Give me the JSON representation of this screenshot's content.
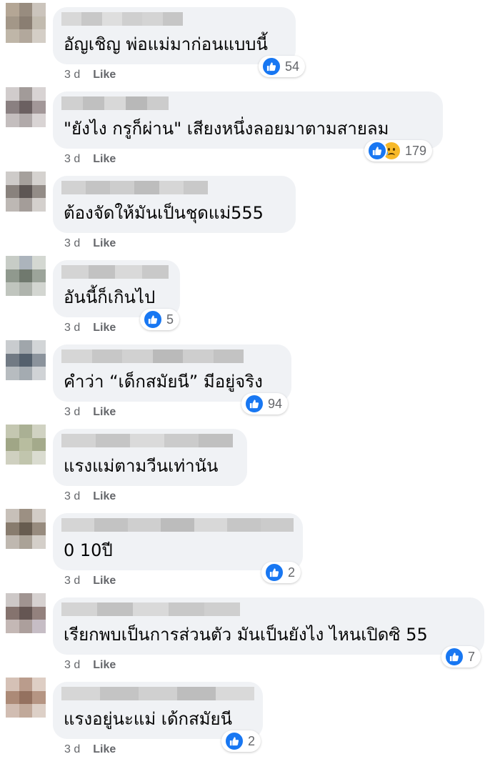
{
  "colors": {
    "bubble": "#f0f2f5",
    "like_blue": "#1877f2",
    "meta_gray": "#65676b",
    "sad_yellow": "#f7b928"
  },
  "comments": [
    {
      "text": "อัญเชิญ พ่อแม่มาก่อนแบบนี้",
      "time": "3 d",
      "like_label": "Like",
      "reaction_count": "54",
      "reactions": [
        "like-icon"
      ],
      "avatar": [
        "#b9a58d",
        "#9c8b79",
        "#cdc4b8",
        "#a89681",
        "#8e7d6c",
        "#c5bba9",
        "#c3b6a2",
        "#b5a896",
        "#d6cec2"
      ],
      "name_blur": [
        "#d8d8d8",
        "#c8c8c8",
        "#dedede",
        "#cfcfcf",
        "#d4d4d4",
        "#c6c6c6"
      ]
    },
    {
      "text": "\"ยังไง กรูก็ผ่าน\" เสียงหนึ่งลอยมาตามสายลม",
      "time": "3 d",
      "like_label": "Like",
      "reaction_count": "179",
      "reactions": [
        "like-icon",
        "sad-icon"
      ],
      "avatar": [
        "#d2cccc",
        "#a59a98",
        "#d9d3d3",
        "#8e7f80",
        "#6f5f60",
        "#a69697",
        "#c6bdbd",
        "#b3a9a9",
        "#dad4d4"
      ],
      "name_blur": [
        "#d0d0d0",
        "#c0c0c0",
        "#d8d8d8",
        "#b8b8b8",
        "#cccccc"
      ]
    },
    {
      "text": "ต้องจัดให้มันเป็นชุดแม่555",
      "time": "3 d",
      "like_label": "Like",
      "reaction_count": "",
      "reactions": [],
      "avatar": [
        "#cfcbc8",
        "#a7a09a",
        "#d6d2ce",
        "#8b817b",
        "#5f5652",
        "#958b85",
        "#bfb8b2",
        "#a69d97",
        "#d5d0cb"
      ],
      "name_blur": [
        "#d2d2d2",
        "#c4c4c4",
        "#cdcdcd",
        "#bdbdbd",
        "#d6d6d6",
        "#c9c9c9"
      ]
    },
    {
      "text": "อันนี้ก็เกินไป",
      "time": "3 d",
      "like_label": "Like",
      "reaction_count": "5",
      "reactions": [
        "like-icon"
      ],
      "avatar": [
        "#c6cdc4",
        "#a9b4c0",
        "#d3d8d0",
        "#8e9a8a",
        "#6d7a6b",
        "#9aa597",
        "#bfc6bc",
        "#aeb5ab",
        "#d2d6cf"
      ],
      "name_blur": [
        "#d4d4d4",
        "#c2c2c2",
        "#d9d9d9",
        "#c9c9c9"
      ]
    },
    {
      "text": "คำว่า “เด็กสมัยนี” มีอยู่จริง",
      "time": "3 d",
      "like_label": "Like",
      "reaction_count": "94",
      "reactions": [
        "like-icon"
      ],
      "avatar": [
        "#c8ccd0",
        "#9ea6ad",
        "#d1d5d8",
        "#6e7b88",
        "#4f6173",
        "#8893a0",
        "#b5bcc2",
        "#a2abb4",
        "#cfd3d7"
      ],
      "name_blur": [
        "#d6d6d6",
        "#c7c7c7",
        "#d1d1d1",
        "#bababa",
        "#cecece",
        "#c3c3c3"
      ]
    },
    {
      "text": "แรงแม่ตามวีนเท่านัน",
      "time": "3 d",
      "like_label": "Like",
      "reaction_count": "",
      "reactions": [],
      "avatar": [
        "#c4c8a8",
        "#a9b18a",
        "#d0d3bc",
        "#9fa87a",
        "#b7be94",
        "#a3ab80",
        "#cfd1b9",
        "#c1c6a4",
        "#dadccb"
      ],
      "name_blur": [
        "#d3d3d3",
        "#c5c5c5",
        "#dadada",
        "#cbcbcb",
        "#c0c0c0"
      ]
    },
    {
      "text": "0 10ปี",
      "time": "3 d",
      "like_label": "Like",
      "reaction_count": "2",
      "reactions": [
        "like-icon"
      ],
      "avatar": [
        "#c9c0b5",
        "#a08f7d",
        "#d4ccc3",
        "#8c7b68",
        "#6b5b4a",
        "#9b8a78",
        "#c2b8ac",
        "#ada292",
        "#d6cfc6"
      ],
      "name_blur": [
        "#d5d5d5",
        "#c3c3c3",
        "#cfcfcf",
        "#bcbcbc",
        "#d8d8d8",
        "#c6c6c6",
        "#cbcbcb"
      ]
    },
    {
      "text": "เรียกพบเป็นการส่วนตัว มันเป็นยังไง ไหนเปิดซิ 55",
      "time": "3 d",
      "like_label": "Like",
      "reaction_count": "7",
      "reactions": [
        "like-icon"
      ],
      "avatar": [
        "#cfc8c6",
        "#a4938f",
        "#d7d1cf",
        "#8b716b",
        "#6a5550",
        "#997f7a",
        "#c8b7b3",
        "#b09e9a",
        "#c9bcc8"
      ],
      "name_blur": [
        "#d4d4d4",
        "#c1c1c1",
        "#d9d9d9",
        "#c8c8c8",
        "#cfcfcf"
      ]
    },
    {
      "text": "แรงอยู่นะแม่ เด้กสมัยนี",
      "time": "3 d",
      "like_label": "Like",
      "reaction_count": "2",
      "reactions": [
        "like-icon"
      ],
      "avatar": [
        "#dcc0b0",
        "#c49a83",
        "#e3cdbf",
        "#b8876d",
        "#a06e55",
        "#c09379",
        "#d8bcab",
        "#c9a792",
        "#e2cfc2"
      ],
      "name_blur": [
        "#d6d6d6",
        "#c4c4c4",
        "#d0d0d0",
        "#bdbdbd",
        "#d9d9d9"
      ]
    }
  ]
}
